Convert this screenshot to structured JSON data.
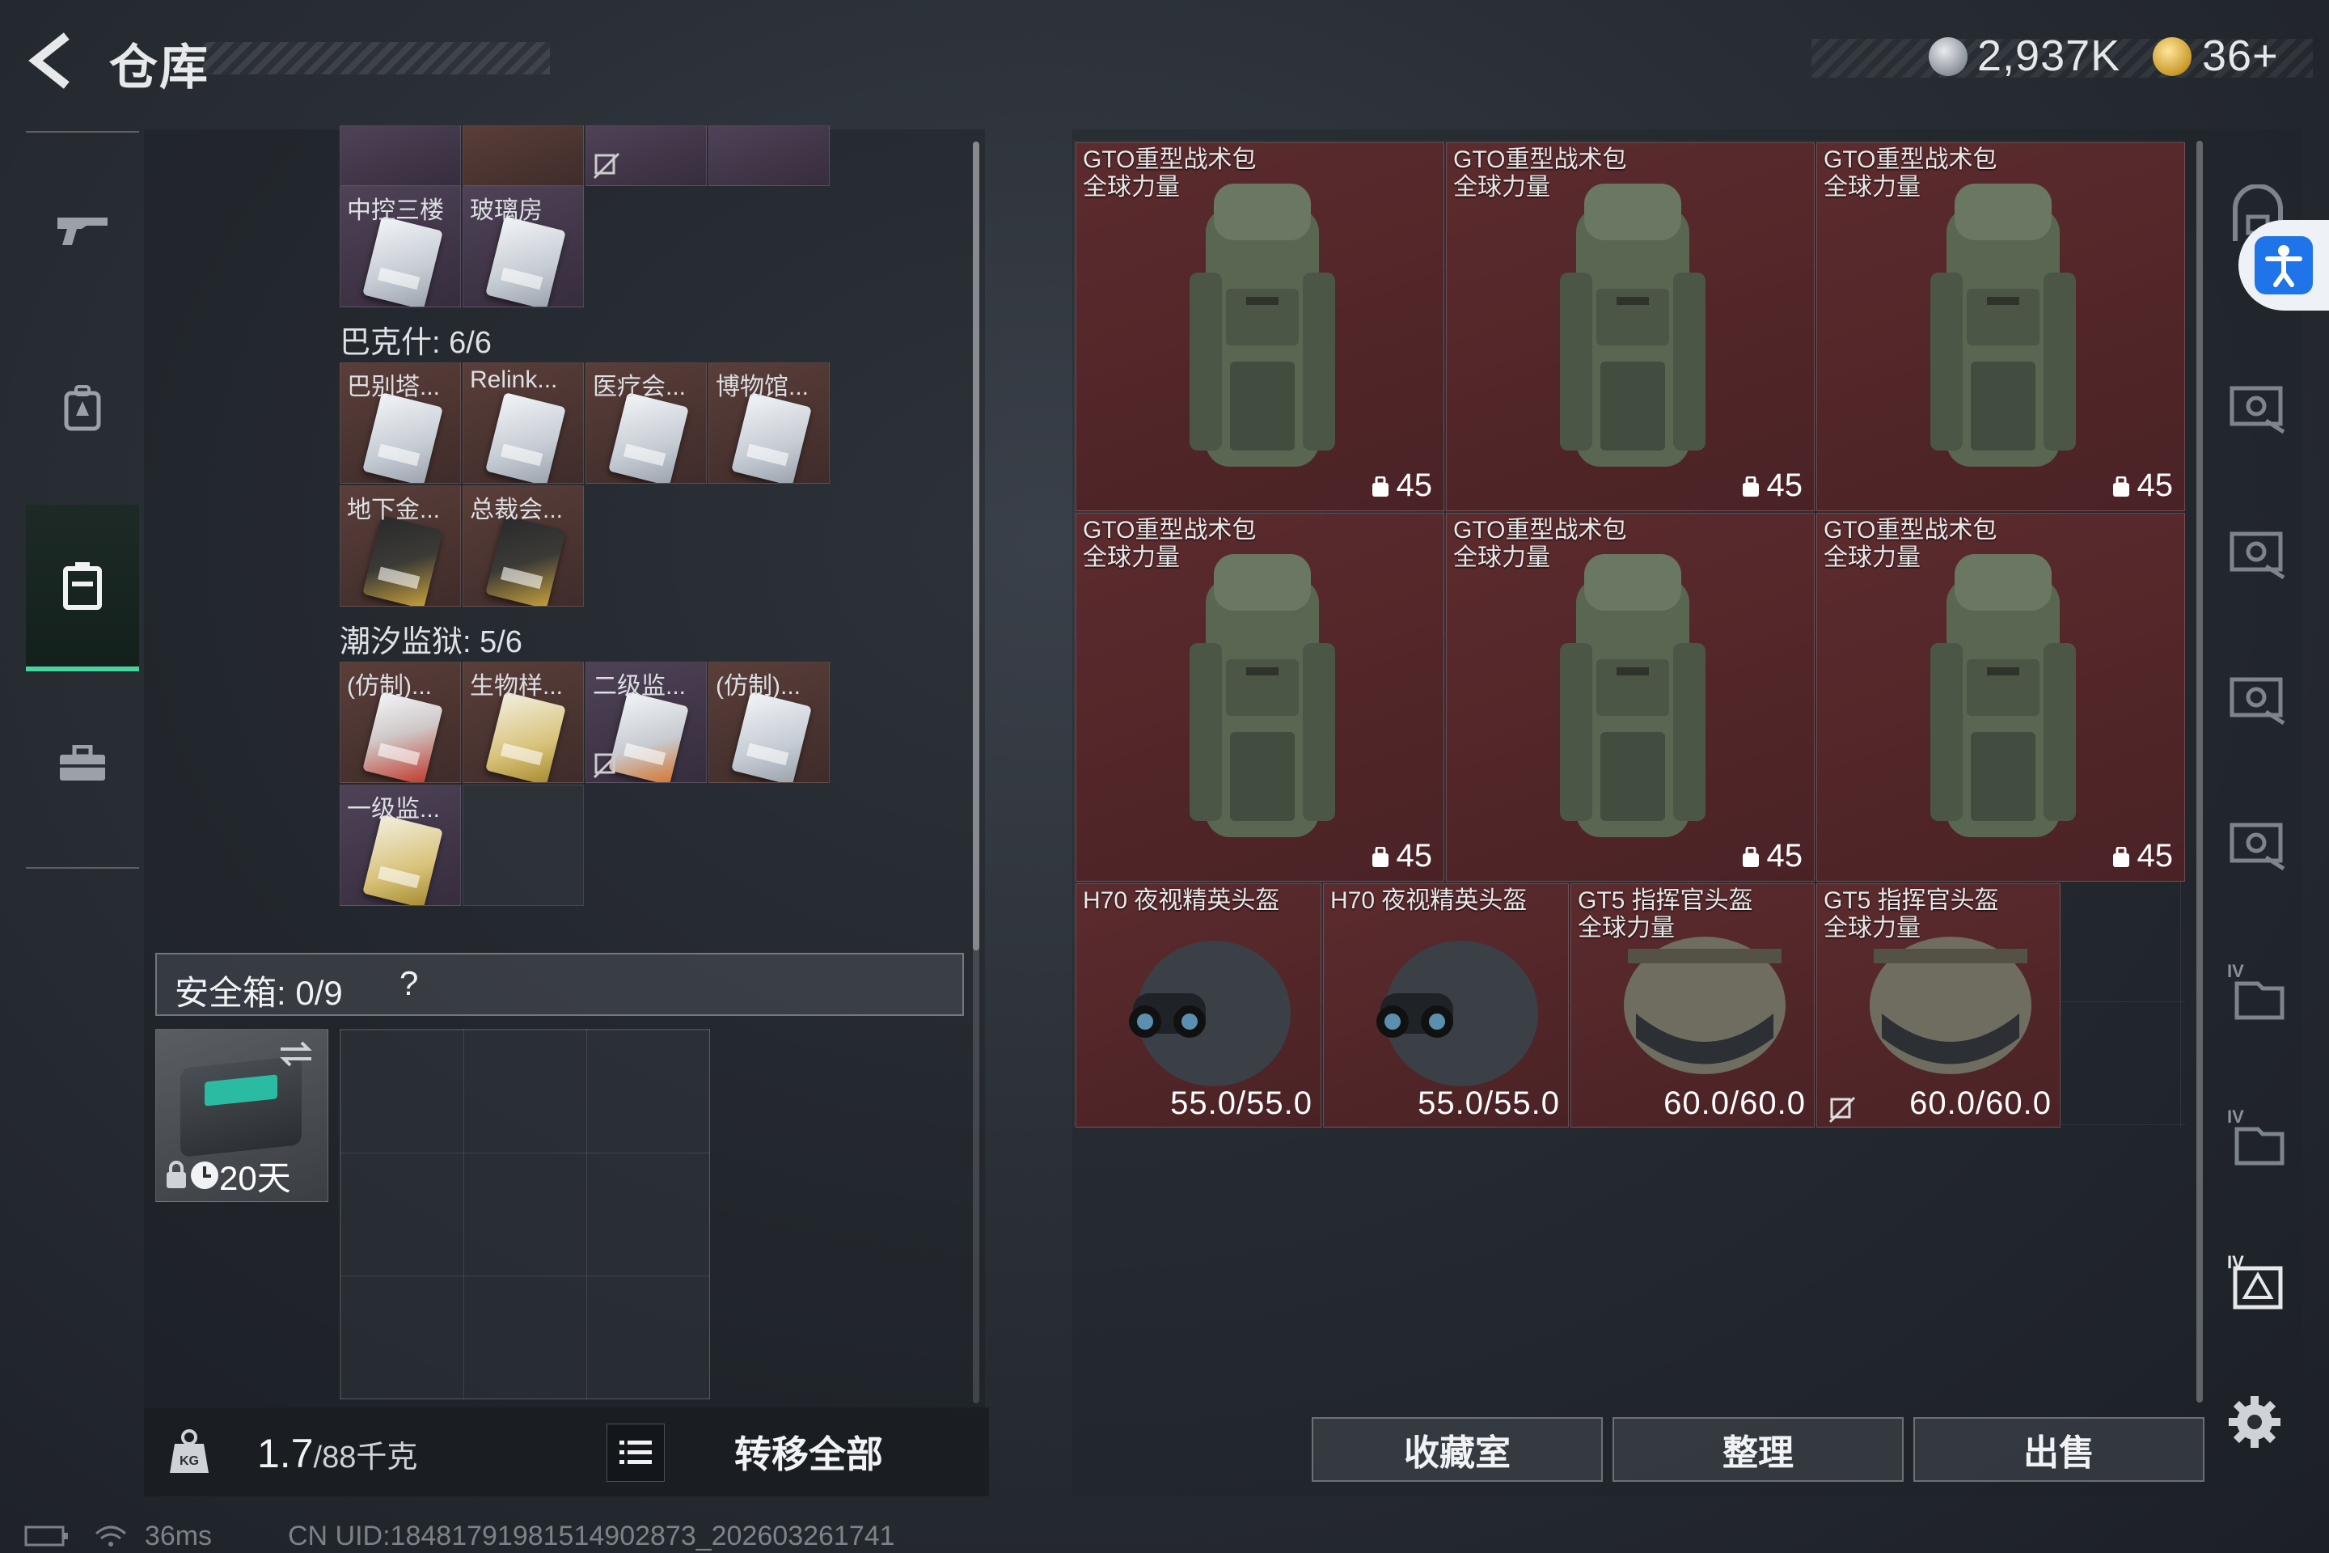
{
  "header": {
    "title": "仓库",
    "currency_silver": "2,937K",
    "currency_gold": "36+"
  },
  "left_nav": {
    "items": [
      {
        "name": "weapons",
        "icon": "gun-icon"
      },
      {
        "name": "backpacks",
        "icon": "backpack-icon"
      },
      {
        "name": "storage",
        "icon": "locker-icon",
        "active": true
      },
      {
        "name": "cases",
        "icon": "briefcase-icon"
      }
    ]
  },
  "inventory": {
    "top_partial_cells": 4,
    "group_0_cells": [
      {
        "label": "中控三楼",
        "card": "silver"
      },
      {
        "label": "玻璃房",
        "card": "silver"
      }
    ],
    "groups": [
      {
        "title": "巴克什: 6/6",
        "cells": [
          {
            "label": "巴别塔...",
            "card": "silver"
          },
          {
            "label": "Relink...",
            "card": "silver"
          },
          {
            "label": "医疗会...",
            "card": "silver"
          },
          {
            "label": "博物馆...",
            "card": "silver"
          },
          {
            "label": "地下金...",
            "card": "gold"
          },
          {
            "label": "总裁会...",
            "card": "gold"
          }
        ]
      },
      {
        "title": "潮汐监狱: 5/6",
        "cells": [
          {
            "label": "(仿制)...",
            "card": "red"
          },
          {
            "label": "生物样...",
            "card": "yellow"
          },
          {
            "label": "二级监...",
            "card": "orange"
          },
          {
            "label": "(仿制)...",
            "card": "silver"
          },
          {
            "label": "一级监...",
            "card": "yellow"
          }
        ]
      }
    ],
    "safe_box": {
      "label": "安全箱: 0/9",
      "help": "?",
      "case_days": "20天"
    },
    "weight": "1.7",
    "weight_max": "/88千克",
    "transfer_all": "转移全部"
  },
  "stash": {
    "backpacks": [
      {
        "name_line1": "GTO重型战术包",
        "name_line2": "全球力量",
        "capacity": "45"
      },
      {
        "name_line1": "GTO重型战术包",
        "name_line2": "全球力量",
        "capacity": "45"
      },
      {
        "name_line1": "GTO重型战术包",
        "name_line2": "全球力量",
        "capacity": "45"
      },
      {
        "name_line1": "GTO重型战术包",
        "name_line2": "全球力量",
        "capacity": "45"
      },
      {
        "name_line1": "GTO重型战术包",
        "name_line2": "全球力量",
        "capacity": "45"
      },
      {
        "name_line1": "GTO重型战术包",
        "name_line2": "全球力量",
        "capacity": "45"
      }
    ],
    "helmets": [
      {
        "name_line1": "H70 夜视精英头盔",
        "name_line2": "",
        "durability": "55.0/55.0"
      },
      {
        "name_line1": "H70 夜视精英头盔",
        "name_line2": "",
        "durability": "55.0/55.0"
      },
      {
        "name_line1": "GT5 指挥官头盔",
        "name_line2": "全球力量",
        "durability": "60.0/60.0"
      },
      {
        "name_line1": "GT5 指挥官头盔",
        "name_line2": "全球力量",
        "durability": "60.0/60.0"
      }
    ],
    "buttons": {
      "collection": "收藏室",
      "organize": "整理",
      "sell": "出售"
    }
  },
  "right_rail": {
    "icons": [
      "stash-tab-icon",
      "accessibility-icon",
      "stash-tab-icon",
      "stash-tab-icon",
      "stash-tab-icon",
      "stash-tab-icon",
      "tier-iv-tab-icon",
      "tier-iv-tab-icon",
      "tier-iv-warning-tab-icon",
      "settings-icon"
    ]
  },
  "status_bar": {
    "ping": "36ms",
    "uid": "CN UID:18481791981514902873_202603261741"
  },
  "colors": {
    "item_bg": "#5c2b2e",
    "active_tab": "#4ad39a",
    "accessibility_blue": "#1e74e8"
  }
}
